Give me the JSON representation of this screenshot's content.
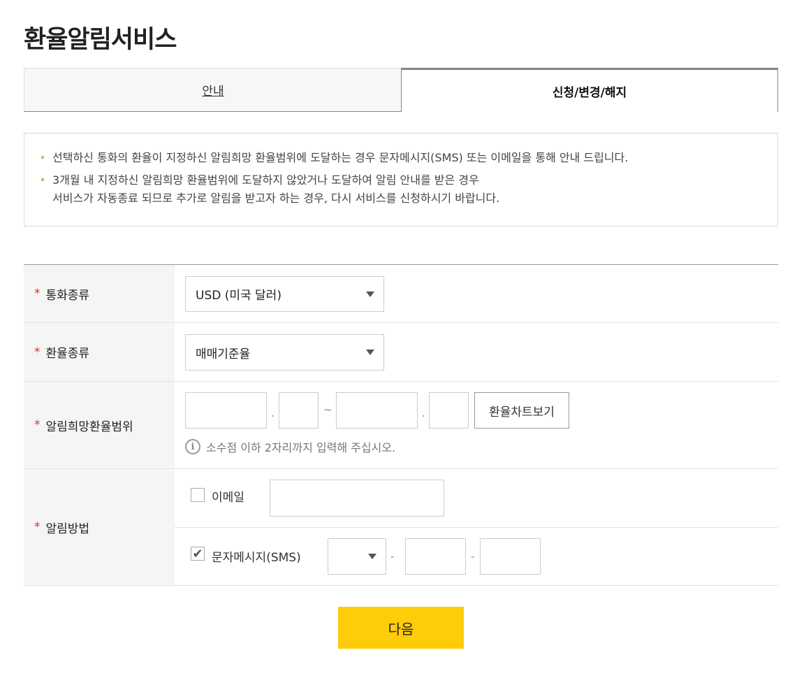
{
  "page": {
    "title": "환율알림서비스"
  },
  "tabs": [
    {
      "label": "안내",
      "active": false
    },
    {
      "label": "신청/변경/해지",
      "active": true
    }
  ],
  "notice": [
    "선택하신 통화의 환율이 지정하신 알림희망 환율범위에 도달하는 경우 문자메시지(SMS) 또는 이메일을 통해 안내 드립니다.",
    "3개월 내 지정하신 알림희망 환율범위에 도달하지 않았거나 도달하여 알림 안내를 받은 경우",
    "서비스가 자동종료 되므로 추가로 알림을 받고자 하는 경우, 다시 서비스를 신청하시기 바랍니다."
  ],
  "form": {
    "required_mark": "*",
    "currency": {
      "label": "통화종류",
      "value": "USD (미국 달러)"
    },
    "rate_type": {
      "label": "환율종류",
      "value": "매매기준율"
    },
    "range": {
      "label": "알림희망환율범위",
      "dot": ".",
      "tilde": "~",
      "chart_button": "환율차트보기",
      "info_icon": "i",
      "hint": "소수점 이하 2자리까지 입력해 주십시오."
    },
    "method": {
      "label": "알림방법",
      "email_label": "이메일",
      "email_checked": false,
      "sms_label": "문자메시지(SMS)",
      "sms_checked": true,
      "check_glyph": "✔",
      "dash": "-"
    }
  },
  "actions": {
    "next_label": "다음"
  },
  "colors": {
    "accent": "#ffcc0a",
    "required": "#e0301e",
    "tab_border": "#8b8178"
  }
}
